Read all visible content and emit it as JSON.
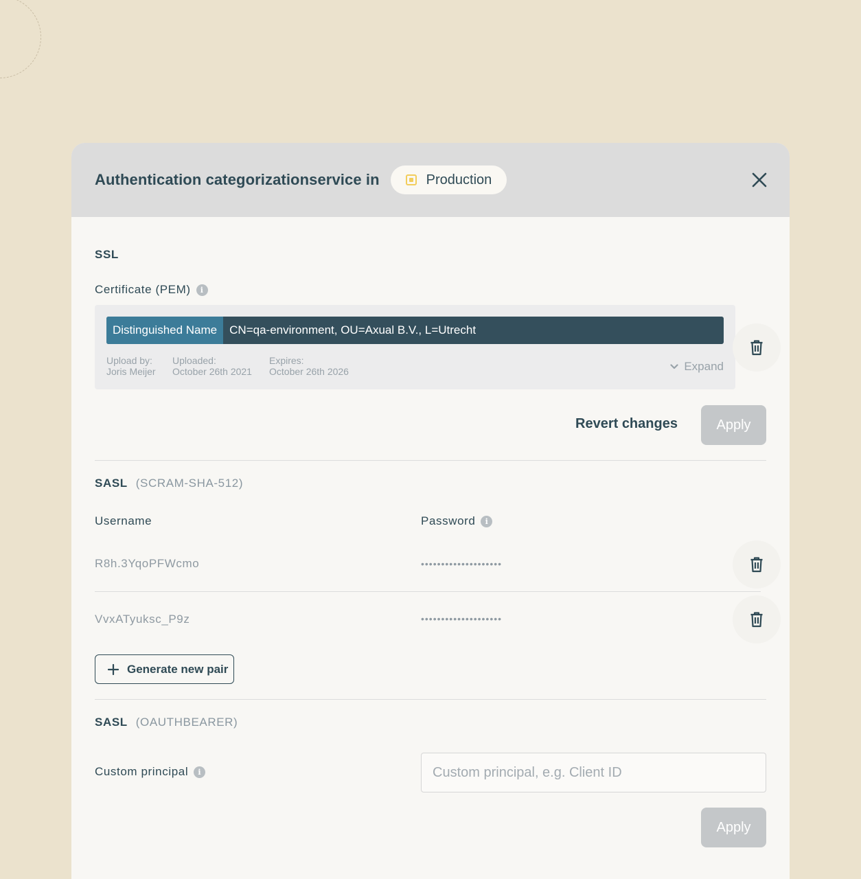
{
  "header": {
    "title": "Authentication categorizationservice in",
    "environment": "Production",
    "env_color": "#f2cd5c",
    "close_icon": "close-icon"
  },
  "ssl": {
    "section_title": "SSL",
    "certificate_label": "Certificate (PEM)",
    "dn_key": "Distinguished Name",
    "dn_value": "CN=qa-environment, OU=Axual B.V., L=Utrecht",
    "upload_by_label": "Upload by:",
    "upload_by_value": "Joris Meijer",
    "uploaded_label": "Uploaded:",
    "uploaded_value": "October 26th 2021",
    "expires_label": "Expires:",
    "expires_value": "October 26th 2026",
    "expand_label": "Expand",
    "revert_label": "Revert changes",
    "apply_label": "Apply"
  },
  "sasl_scram": {
    "section_title": "SASL",
    "mechanism": "(SCRAM-SHA-512)",
    "username_header": "Username",
    "password_header": "Password",
    "pairs": [
      {
        "username": "R8h.3YqoPFWcmo",
        "password": "••••••••••••••••••••"
      },
      {
        "username": "VvxATyuksc_P9z",
        "password": "••••••••••••••••••••"
      }
    ],
    "generate_label": "Generate new pair"
  },
  "sasl_oauth": {
    "section_title": "SASL",
    "mechanism": "(OAUTHBEARER)",
    "principal_label": "Custom principal",
    "principal_placeholder": "Custom principal, e.g. Client ID",
    "principal_value": "",
    "apply_label": "Apply"
  }
}
